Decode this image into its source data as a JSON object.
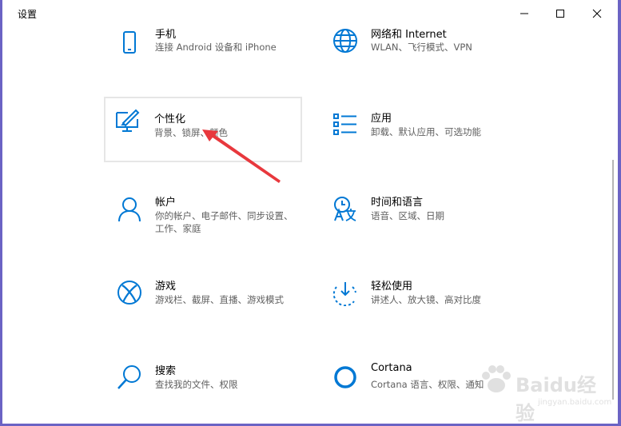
{
  "window": {
    "title": "设置"
  },
  "colors": {
    "accent": "#0078d4",
    "arrow": "#e8383d"
  },
  "tiles": [
    {
      "id": "phone",
      "title": "手机",
      "desc": "连接 Android 设备和 iPhone",
      "icon": "phone-icon"
    },
    {
      "id": "network",
      "title": "网络和 Internet",
      "desc": "WLAN、飞行模式、VPN",
      "icon": "globe-icon"
    },
    {
      "id": "personalization",
      "title": "个性化",
      "desc": "背景、锁屏、颜色",
      "icon": "paint-monitor-icon"
    },
    {
      "id": "apps",
      "title": "应用",
      "desc": "卸载、默认应用、可选功能",
      "icon": "apps-list-icon"
    },
    {
      "id": "accounts",
      "title": "帐户",
      "desc": "你的帐户、电子邮件、同步设置、工作、家庭",
      "icon": "person-icon"
    },
    {
      "id": "time",
      "title": "时间和语言",
      "desc": "语音、区域、日期",
      "icon": "time-language-icon"
    },
    {
      "id": "gaming",
      "title": "游戏",
      "desc": "游戏栏、截屏、直播、游戏模式",
      "icon": "xbox-icon"
    },
    {
      "id": "ease",
      "title": "轻松使用",
      "desc": "讲述人、放大镜、高对比度",
      "icon": "ease-of-access-icon"
    },
    {
      "id": "search",
      "title": "搜索",
      "desc": "查找我的文件、权限",
      "icon": "search-icon"
    },
    {
      "id": "cortana",
      "title": "Cortana",
      "desc": "Cortana 语言、权限、通知",
      "icon": "cortana-icon"
    }
  ],
  "watermark": {
    "text": "Baidu经验",
    "sub": "jingyan.baidu.com"
  }
}
